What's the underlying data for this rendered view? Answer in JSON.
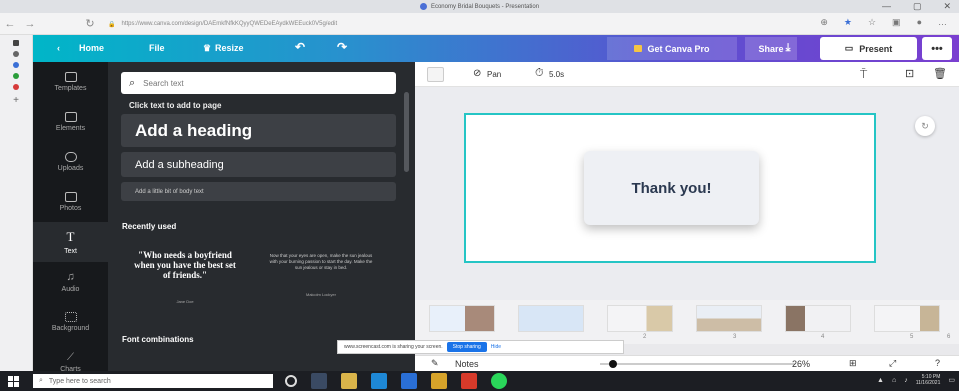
{
  "browser": {
    "tab_title": "Economy Bridal Bouquets - Presentation",
    "url": "https://www.canva.com/design/DAEmkfNfkKQyyQWEDeEAydkWEEuck0V5g/edit",
    "min": "—",
    "max": "▢",
    "close": "✕"
  },
  "toolbar": {
    "home": "Home",
    "file": "File",
    "resize": "Resize",
    "undo": "↶",
    "redo": "↷",
    "get_pro": "Get Canva Pro",
    "share": "Share",
    "download": "⤓",
    "present": "Present",
    "more": "•••"
  },
  "sidebar": {
    "items": [
      {
        "label": "Templates"
      },
      {
        "label": "Elements"
      },
      {
        "label": "Uploads"
      },
      {
        "label": "Photos"
      },
      {
        "label": "Text"
      },
      {
        "label": "Audio"
      },
      {
        "label": "Background"
      },
      {
        "label": "Charts"
      }
    ]
  },
  "panel": {
    "search_placeholder": "Search text",
    "hint": "Click text to add to page",
    "add_heading": "Add a heading",
    "add_subheading": "Add a subheading",
    "add_body": "Add a little bit of body text",
    "recently_used": "Recently used",
    "quote1": "\"Who needs a boyfriend when you have the best set of friends.\"",
    "quote1_author": "Jane Doe",
    "quote2": "Now that your eyes are open, make the sun jealous with your burning passion to start the day. Make the sun jealous or stay in bed.",
    "quote2_author": "Malcolm Lockyer",
    "font_combinations": "Font combinations"
  },
  "editor": {
    "pan": "Pan",
    "duration": "5.0s",
    "slide_text": "Thank you!"
  },
  "filmstrip": {
    "numbers": [
      "2",
      "3",
      "4",
      "5",
      "6"
    ]
  },
  "share_banner": {
    "message": "www.screencast.com is sharing your screen.",
    "stop": "Stop sharing",
    "hide": "Hide"
  },
  "statusbar": {
    "notes": "Notes",
    "zoom": "26%",
    "help": "?"
  },
  "taskbar": {
    "search": "Type here to search",
    "time": "5:10 PM",
    "date": "11/16/2021"
  },
  "colors": {
    "accent_teal": "#00b6c8",
    "accent_purple": "#7a3fd0",
    "panel_dark": "#282b2f",
    "page_border": "#25c5c5"
  }
}
